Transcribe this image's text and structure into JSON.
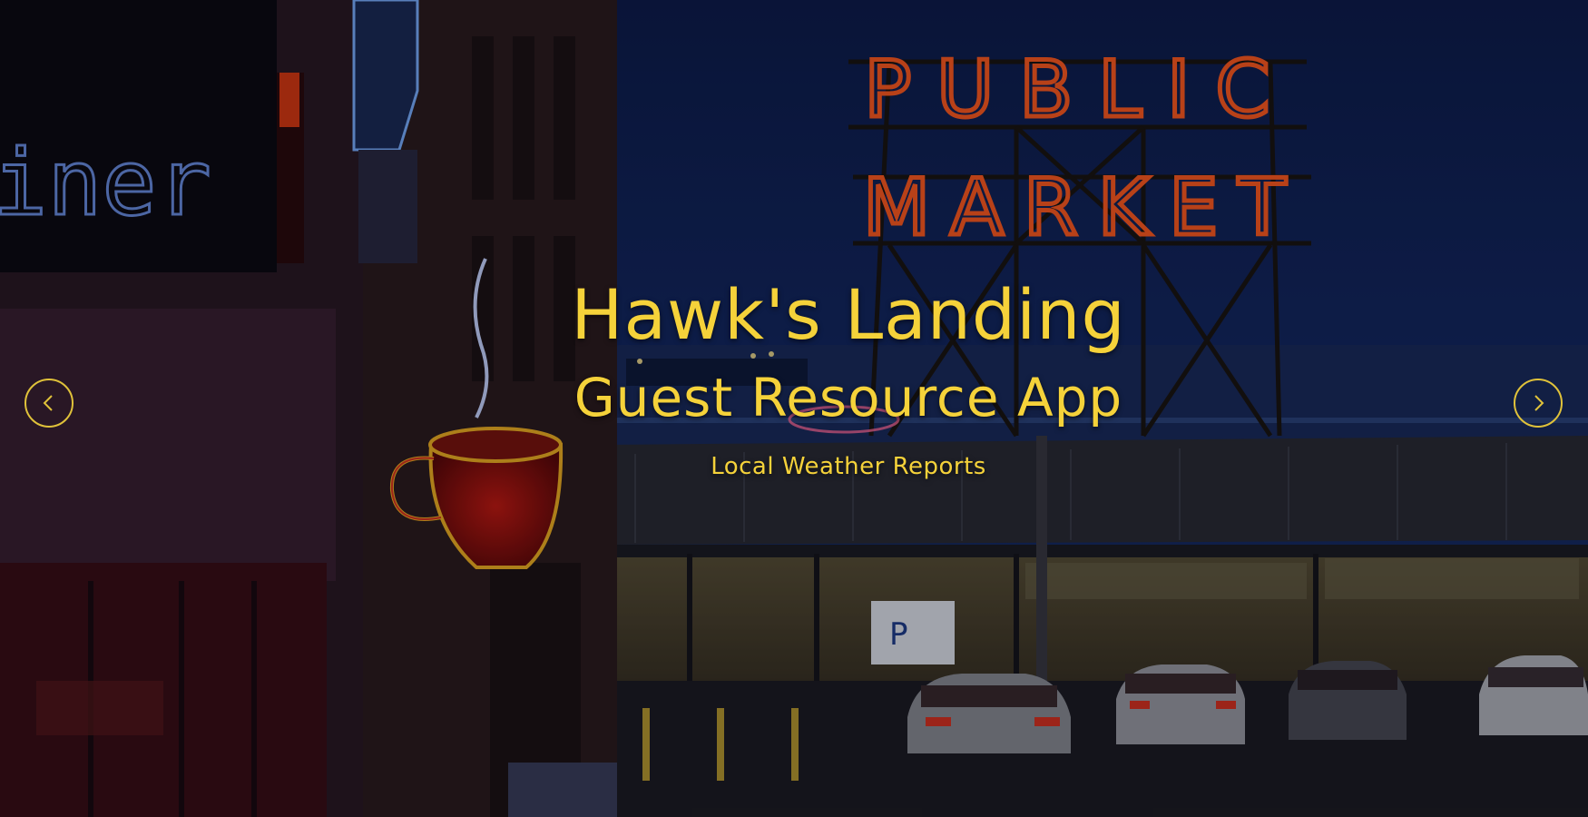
{
  "hero": {
    "title": "Hawk's Landing",
    "subtitle": "Guest Resource App",
    "tagline": "Local Weather Reports",
    "sign_line1": "PUBLIC",
    "sign_line2": "MARKET",
    "diner_text": "iner",
    "accent_color": "#f5d23a"
  },
  "carousel": {
    "prev_icon": "chevron-left-icon",
    "next_icon": "chevron-right-icon"
  }
}
